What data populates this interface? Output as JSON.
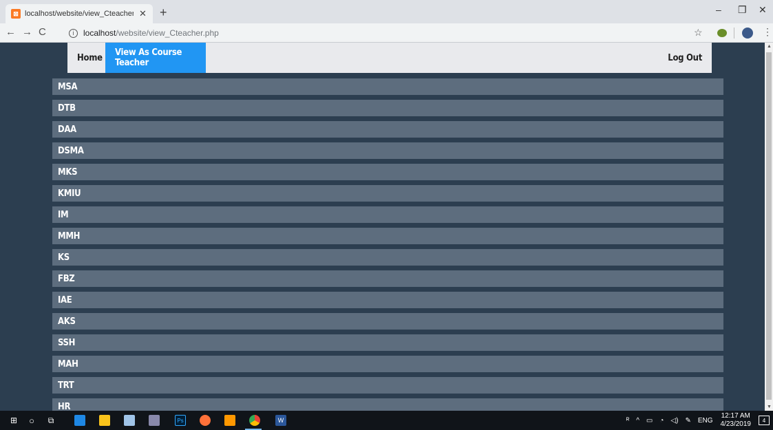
{
  "browser": {
    "tab_title": "localhost/website/view_Cteacher",
    "tab_favicon": "xampp-icon",
    "new_tab": "+",
    "url_host": "localhost",
    "url_path": "/website/view_Cteacher.php",
    "window_controls": [
      "–",
      "❐",
      "✕"
    ]
  },
  "navbar": {
    "home": "Home",
    "active": "View As Course Teacher",
    "logout": "Log Out",
    "active_color": "#2196f3"
  },
  "courses": [
    "MSA",
    "DTB",
    "DAA",
    "DSMA",
    "MKS",
    "KMIU",
    "IM",
    "MMH",
    "KS",
    "FBZ",
    "IAE",
    "AKS",
    "SSH",
    "MAH",
    "TRT",
    "HR"
  ],
  "taskbar": {
    "time": "12:17 AM",
    "date": "4/23/2019",
    "lang": "ENG",
    "notifications": "4"
  },
  "colors": {
    "page_bg": "#2c3e50",
    "row_bg": "#5d6d7e"
  }
}
